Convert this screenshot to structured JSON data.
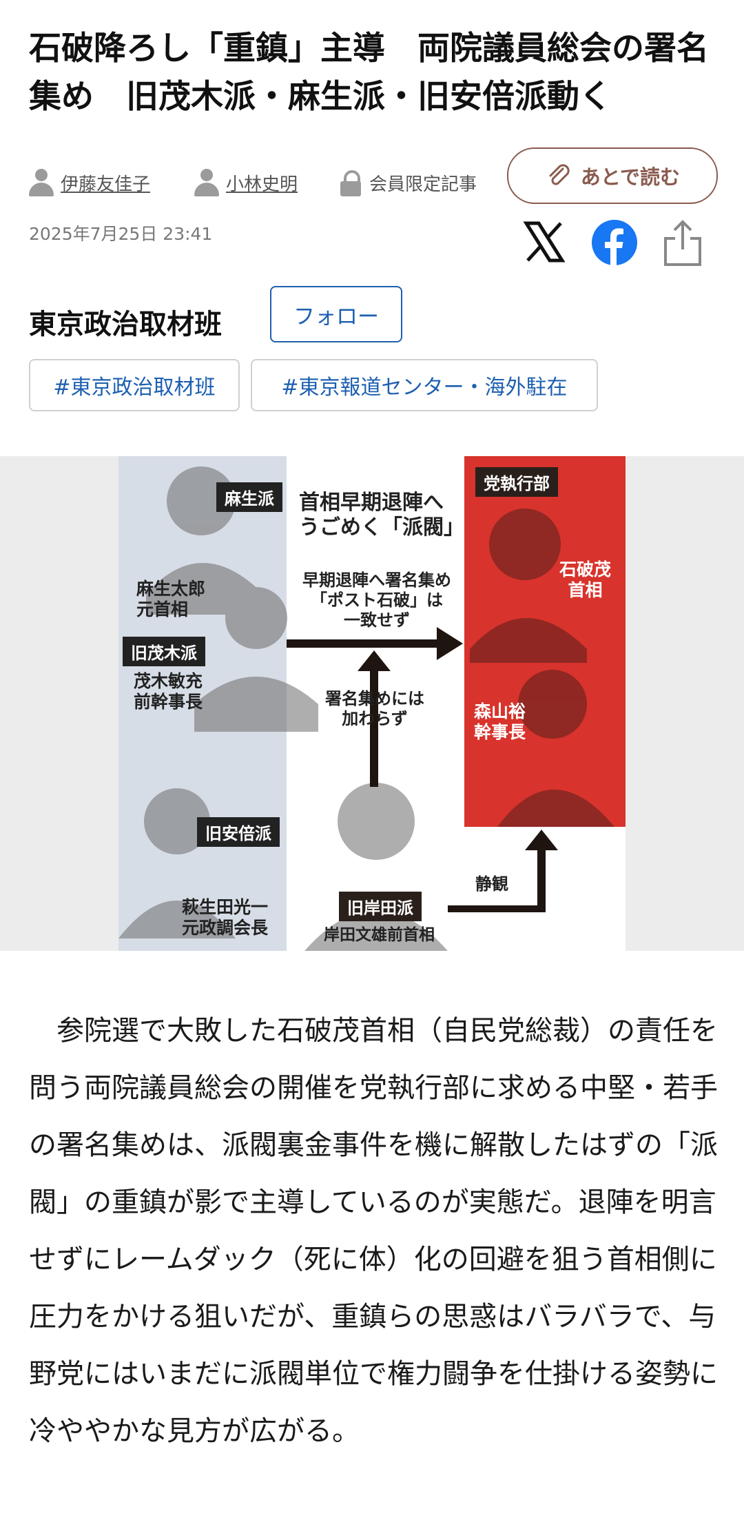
{
  "article": {
    "title": "石破降ろし「重鎮」主導　両院議員総会の署名集め　旧茂木派・麻生派・旧安倍派動く",
    "authors": [
      "伊藤友佳子",
      "小林史明"
    ],
    "member_only_label": "会員限定記事",
    "read_later_label": "あとで読む",
    "date": "2025年7月25日 23:41",
    "desk": "東京政治取材班",
    "follow_label": "フォロー",
    "tags": [
      "#東京政治取材班",
      "#東京報道センター・海外駐在"
    ],
    "body": "　参院選で大敗した石破茂首相（自民党総裁）の責任を問う両院議員総会の開催を党執行部に求める中堅・若手の署名集めは、派閥裏金事件を機に解散したはずの「派閥」の重鎮が影で主導しているのが実態だ。退陣を明言せずにレームダック（死に体）化の回避を狙う首相側に圧力をかける狙いだが、重鎮らの思惑はバラバラで、与野党にはいまだに派閥単位で権力闘争を仕掛ける姿勢に冷ややかな見方が広がる。"
  },
  "share": {
    "icons": [
      "x-icon",
      "facebook-icon",
      "share-icon"
    ],
    "facebook_color": "#1877f2"
  },
  "figure": {
    "heading": "首相早期退陣へ\nうごめく「派閥」",
    "arrow_top_label": "早期退陣へ署名集め\n「ポスト石破」は\n一致せず",
    "arrow_mid_label": "署名集めには\n加わらず",
    "arrow_bottom_label": "静観",
    "left": [
      {
        "faction": "麻生派",
        "person": "麻生太郎\n元首相"
      },
      {
        "faction": "旧茂木派",
        "person": "茂木敏充\n前幹事長"
      },
      {
        "faction": "旧安倍派",
        "person": "萩生田光一\n元政調会長"
      }
    ],
    "bottom": {
      "faction": "旧岸田派",
      "person": "岸田文雄前首相"
    },
    "right": {
      "faction": "党執行部",
      "people": [
        "石破茂\n首相",
        "森山裕\n幹事長"
      ]
    },
    "colors": {
      "right_panel": "#d8332c",
      "left_panel": "#d7dde6",
      "arrow": "#1e1410"
    }
  }
}
